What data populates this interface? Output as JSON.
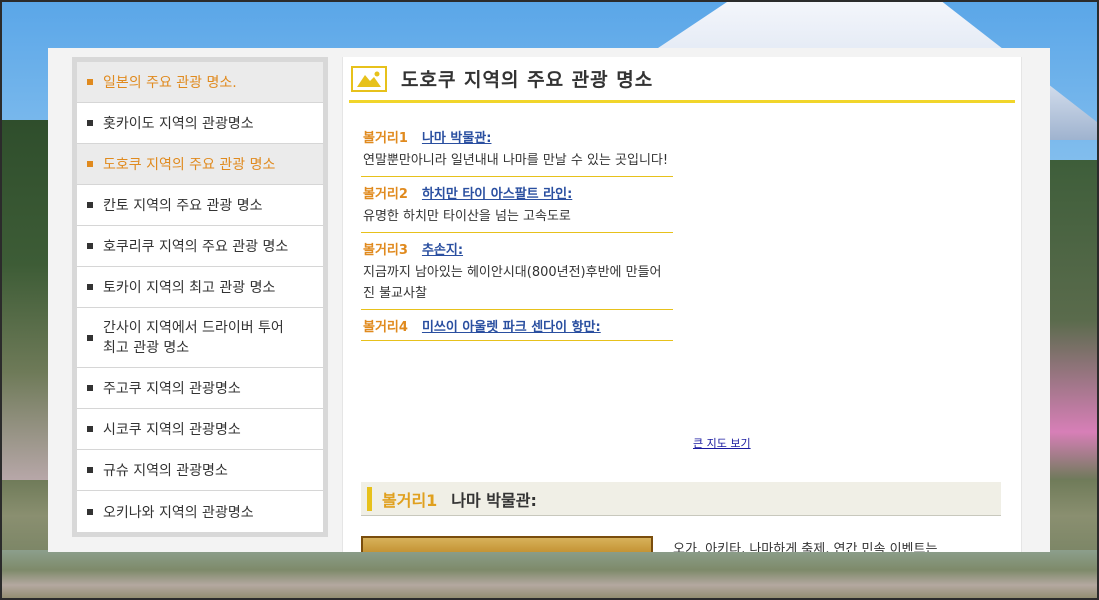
{
  "sidebar": {
    "items": [
      {
        "label": "일본의 주요 관광 명소.",
        "active": true
      },
      {
        "label": "홋카이도 지역의 관광명소",
        "active": false
      },
      {
        "label": "도호쿠 지역의 주요 관광 명소",
        "active": true
      },
      {
        "label": "칸토 지역의 주요 관광 명소",
        "active": false
      },
      {
        "label": "호쿠리쿠 지역의 주요 관광 명소",
        "active": false
      },
      {
        "label": "토카이 지역의 최고 관광 명소",
        "active": false
      },
      {
        "label": "간사이 지역에서 드라이버 투어 최고 관광 명소",
        "active": false
      },
      {
        "label": "주고쿠 지역의 관광명소",
        "active": false
      },
      {
        "label": "시코쿠 지역의 관광명소",
        "active": false
      },
      {
        "label": "규슈 지역의 관광명소",
        "active": false
      },
      {
        "label": "오키나와 지역의 관광명소",
        "active": false
      }
    ]
  },
  "main": {
    "title": "도호쿠 지역의 주요 관광 명소",
    "spots": [
      {
        "num": "볼거리1",
        "name": "나마 박물관:",
        "desc": "연말뿐만아니라 일년내내 나마를 만날 수 있는 곳입니다!"
      },
      {
        "num": "볼거리2",
        "name": "하치만 타이 아스팔트 라인:",
        "desc": "유명한 하치만 타이산을 넘는 고속도로"
      },
      {
        "num": "볼거리3",
        "name": "추손지:",
        "desc": "지금까지 남아있는 헤이안시대(800년전)후반에 만들어진 불교사찰"
      },
      {
        "num": "볼거리4",
        "name": "미쓰이 아울렛 파크 센다이 항만:",
        "desc": ""
      }
    ],
    "map_link": "큰 지도 보기",
    "section": {
      "num": "볼거리1",
      "title": "나마 박물관:"
    },
    "body_text": "오가, 아키타, 나마하게 축제, 연간 민속 이벤트는"
  },
  "colors": {
    "accent": "#e08a1e",
    "gold": "#e7c11b",
    "link": "#2a4fa0"
  }
}
